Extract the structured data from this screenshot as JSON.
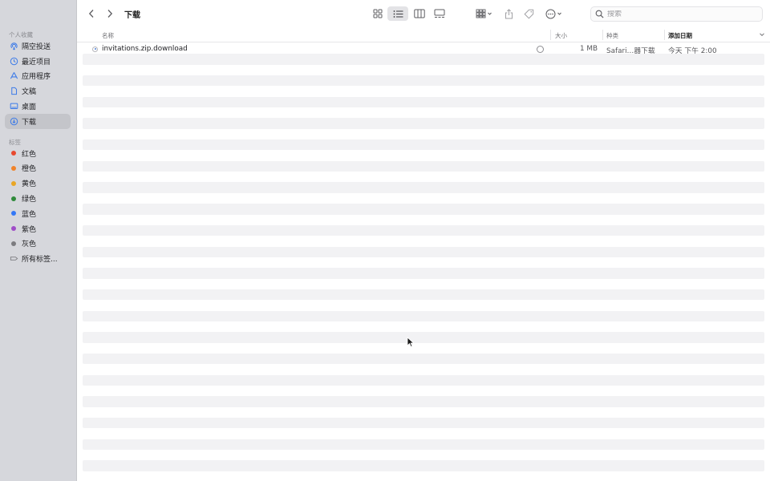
{
  "sidebar": {
    "favorites_title": "个人收藏",
    "favorites": [
      {
        "label": "隔空投送",
        "icon": "airdrop-icon"
      },
      {
        "label": "最近项目",
        "icon": "clock-icon"
      },
      {
        "label": "应用程序",
        "icon": "applications-icon"
      },
      {
        "label": "文稿",
        "icon": "document-icon"
      },
      {
        "label": "桌面",
        "icon": "desktop-icon"
      },
      {
        "label": "下载",
        "icon": "download-icon",
        "active": true
      }
    ],
    "tags_title": "标签",
    "tags": [
      {
        "label": "红色",
        "color": "#e8492f"
      },
      {
        "label": "橙色",
        "color": "#f0832b"
      },
      {
        "label": "黄色",
        "color": "#e9a626"
      },
      {
        "label": "绿色",
        "color": "#2f8a3a"
      },
      {
        "label": "蓝色",
        "color": "#3478f6"
      },
      {
        "label": "紫色",
        "color": "#a04dc8"
      },
      {
        "label": "灰色",
        "color": "#7c7c80"
      }
    ],
    "all_tags": "所有标签..."
  },
  "toolbar": {
    "title": "下载",
    "back_icon": "chevron-left-icon",
    "forward_icon": "chevron-right-icon",
    "view_modes": [
      "icon-view-icon",
      "list-view-icon",
      "column-view-icon",
      "gallery-view-icon"
    ],
    "active_view": "list-view-icon",
    "search_placeholder": "搜索"
  },
  "columns": {
    "name": "名称",
    "size": "大小",
    "kind": "种类",
    "date_added": "添加日期"
  },
  "files": [
    {
      "name": "invitations.zip.download",
      "size": "1 MB",
      "kind": "Safari…器下载",
      "date_added": "今天 下午 2:00"
    }
  ],
  "colors": {
    "sidebar_bg": "#d6d7dc",
    "row_stripe": "#f2f2f4",
    "accent": "#3478f6"
  }
}
